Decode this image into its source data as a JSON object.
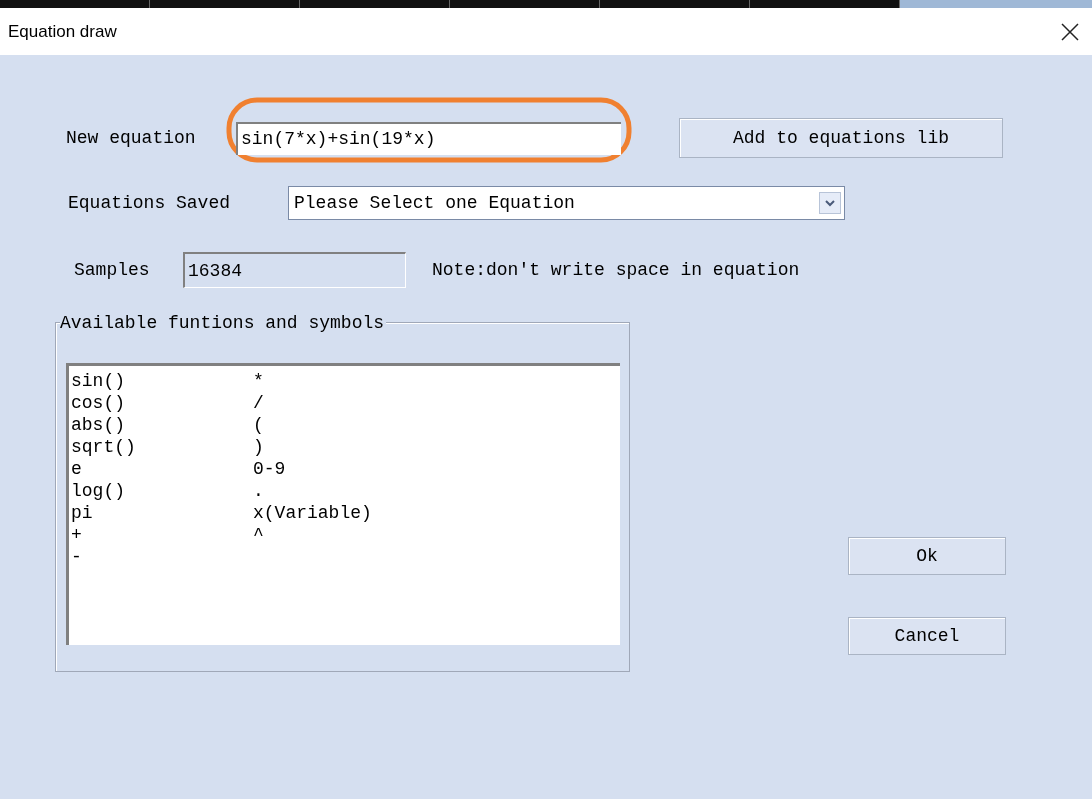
{
  "window": {
    "title": "Equation draw"
  },
  "new_equation": {
    "label": "New equation",
    "value": "sin(7*x)+sin(19*x)"
  },
  "add_button": "Add to equations lib",
  "equations_saved": {
    "label": "Equations Saved",
    "value": "Please Select one Equation"
  },
  "samples": {
    "label": "Samples",
    "value": "16384",
    "disabled": true
  },
  "note": "Note:don't write space in equation",
  "functions_group": {
    "title": "Available funtions and symbols",
    "rows": [
      {
        "column_1": "sin()",
        "column_2": "*"
      },
      {
        "column_1": "cos()",
        "column_2": "/"
      },
      {
        "column_1": "abs()",
        "column_2": "("
      },
      {
        "column_1": "sqrt()",
        "column_2": ")"
      },
      {
        "column_1": "e",
        "column_2": "0-9"
      },
      {
        "column_1": "log()",
        "column_2": "."
      },
      {
        "column_1": "pi",
        "column_2": "x(Variable)"
      },
      {
        "column_1": "+",
        "column_2": "^"
      },
      {
        "column_1": "-"
      }
    ]
  },
  "buttons": [
    "Ok",
    "Cancel"
  ]
}
